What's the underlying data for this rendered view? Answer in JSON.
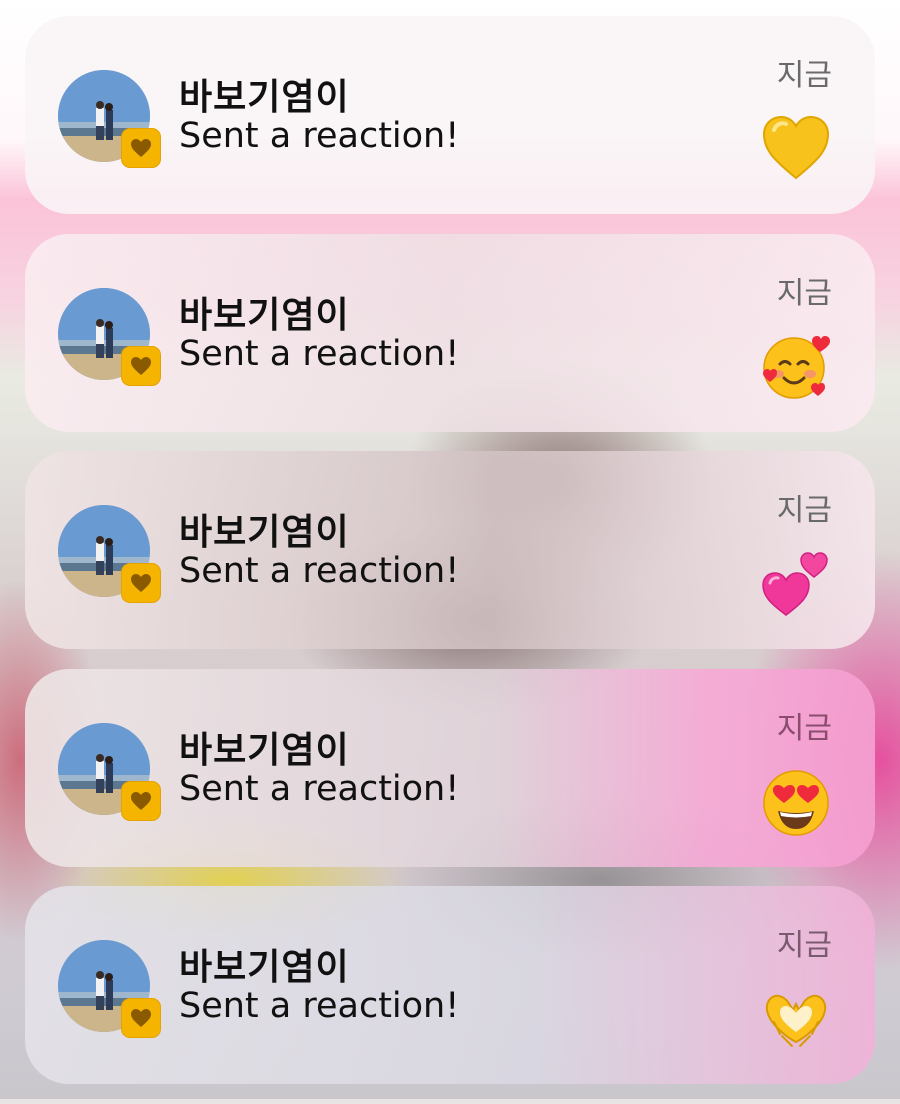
{
  "notifications": [
    {
      "sender": "바보기염이",
      "message": "Sent a reaction!",
      "time": "지금",
      "reaction_icon": "yellow-heart-emoji"
    },
    {
      "sender": "바보기염이",
      "message": "Sent a reaction!",
      "time": "지금",
      "reaction_icon": "smiling-face-with-hearts-emoji"
    },
    {
      "sender": "바보기염이",
      "message": "Sent a reaction!",
      "time": "지금",
      "reaction_icon": "two-hearts-emoji"
    },
    {
      "sender": "바보기염이",
      "message": "Sent a reaction!",
      "time": "지금",
      "reaction_icon": "heart-eyes-emoji"
    },
    {
      "sender": "바보기염이",
      "message": "Sent a reaction!",
      "time": "지금",
      "reaction_icon": "heart-hands-emoji"
    }
  ],
  "colors": {
    "app_badge": "#f4b400",
    "text": "#111111",
    "time": "#6a6a6a"
  }
}
